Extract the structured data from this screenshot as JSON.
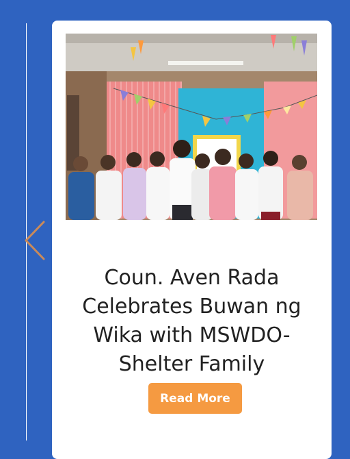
{
  "card": {
    "image_alt": "Group photo of women and a man posing in front of festive bunting and draped fabric backdrop",
    "title": "Coun. Aven Rada Celebrates Buwan ng Wika with MSWDO-Shelter Family",
    "read_more_label": "Read More"
  },
  "navigation": {
    "prev_icon": "chevron-left-icon"
  },
  "colors": {
    "page_background": "#2f63c0",
    "card_background": "#ffffff",
    "button_background": "#f59a41",
    "button_text": "#ffffff",
    "title_text": "#222222",
    "arrow": "#c98a5a"
  }
}
